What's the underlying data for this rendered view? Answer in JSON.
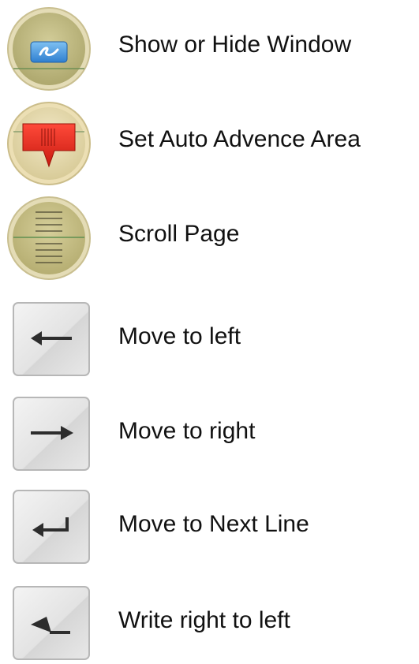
{
  "legend": {
    "items": [
      {
        "label": "Show or Hide Window",
        "icon": "show-hide-window-icon"
      },
      {
        "label": "Set Auto Advence Area",
        "icon": "auto-advance-marker-icon"
      },
      {
        "label": "Scroll Page",
        "icon": "scroll-page-icon"
      },
      {
        "label": "Move to left",
        "icon": "arrow-left-icon"
      },
      {
        "label": "Move to right",
        "icon": "arrow-right-icon"
      },
      {
        "label": "Move to Next Line",
        "icon": "return-arrow-icon"
      },
      {
        "label": "Write right to left",
        "icon": "write-rtl-icon"
      }
    ]
  },
  "colors": {
    "button_ring": "#d6cca0",
    "button_face": "#c2bc86",
    "blue_window": "#3a8fd8",
    "red_marker": "#e0261c",
    "key_face": "#e6e6e6",
    "key_border": "#b9b9b9",
    "arrow": "#2d2d2d"
  }
}
